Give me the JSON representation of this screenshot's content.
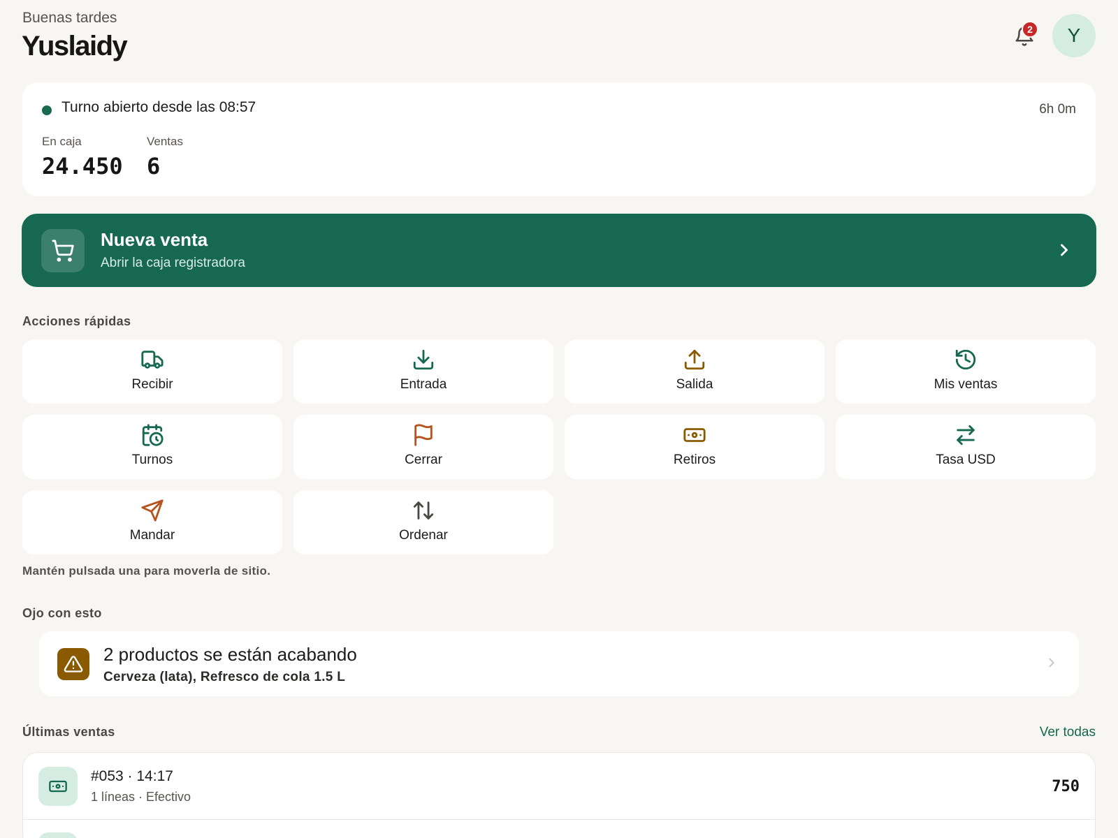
{
  "header": {
    "greeting": "Buenas tardes",
    "username": "Yuslaidy",
    "notifications_count": "2",
    "avatar_initial": "Y"
  },
  "shift": {
    "status": "Turno abierto desde las 08:57",
    "duration": "6h 0m",
    "cash_label": "En caja",
    "cash_value": "24.450",
    "sales_label": "Ventas",
    "sales_value": "6"
  },
  "new_sale": {
    "title": "Nueva venta",
    "subtitle": "Abrir la caja registradora"
  },
  "quick_actions": {
    "title": "Acciones rápidas",
    "items": [
      {
        "label": "Recibir",
        "icon": "truck-icon"
      },
      {
        "label": "Entrada",
        "icon": "download-icon"
      },
      {
        "label": "Salida",
        "icon": "upload-icon"
      },
      {
        "label": "Mis ventas",
        "icon": "history-icon"
      },
      {
        "label": "Turnos",
        "icon": "calendar-clock-icon"
      },
      {
        "label": "Cerrar",
        "icon": "flag-icon"
      },
      {
        "label": "Retiros",
        "icon": "banknote-icon"
      },
      {
        "label": "Tasa USD",
        "icon": "exchange-icon"
      },
      {
        "label": "Mandar",
        "icon": "send-icon"
      },
      {
        "label": "Ordenar",
        "icon": "sort-arrows-icon"
      }
    ],
    "hint": "Mantén pulsada una para moverla de sitio."
  },
  "alerts": {
    "title": "Ojo con esto",
    "item": {
      "title": "2 productos se están acabando",
      "subtitle": "Cerveza (lata), Refresco de cola 1.5 L"
    }
  },
  "recent_sales": {
    "title": "Últimas ventas",
    "see_all": "Ver todas",
    "rows": [
      {
        "id_time": "#053 · 14:17",
        "meta": "1 líneas · Efectivo",
        "total": "750"
      }
    ]
  },
  "colors": {
    "brand_green": "#166851",
    "background": "#f8f6f2",
    "accent_orange": "#b5541f",
    "accent_brown": "#8a5a00",
    "badge_red": "#c62828"
  }
}
